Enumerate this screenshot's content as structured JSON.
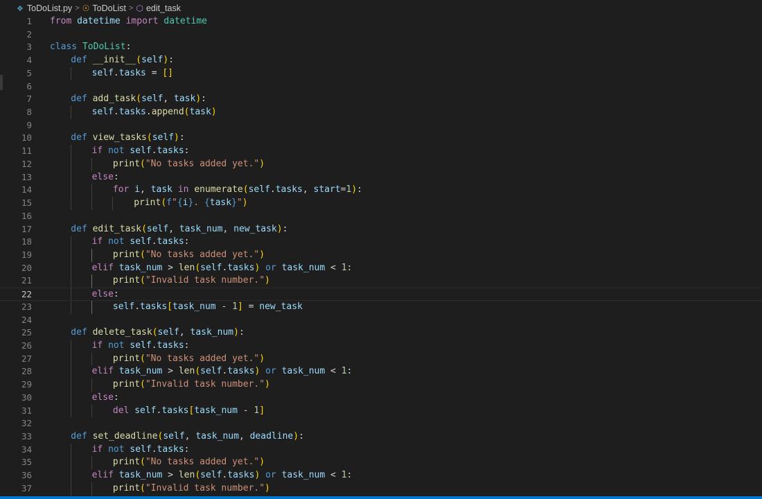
{
  "breadcrumb": {
    "file": "ToDoList.py",
    "class": "ToDoList",
    "method": "edit_task",
    "sep": ">"
  },
  "icons": {
    "python_file": "python-file-icon",
    "class": "class-symbol-icon",
    "method": "method-symbol-icon"
  },
  "editor": {
    "current_line": 22,
    "lines": [
      {
        "n": "1",
        "indent": 0,
        "tokens": [
          [
            "kw",
            "from"
          ],
          [
            "pn",
            " "
          ],
          [
            "vr",
            "datetime"
          ],
          [
            "pn",
            " "
          ],
          [
            "kw",
            "import"
          ],
          [
            "pn",
            " "
          ],
          [
            "cls",
            "datetime"
          ]
        ]
      },
      {
        "n": "2",
        "indent": 0,
        "tokens": []
      },
      {
        "n": "3",
        "indent": 0,
        "tokens": [
          [
            "dk",
            "class"
          ],
          [
            "pn",
            " "
          ],
          [
            "cls",
            "ToDoList"
          ],
          [
            "pn",
            ":"
          ]
        ]
      },
      {
        "n": "4",
        "indent": 1,
        "tokens": [
          [
            "dk",
            "def"
          ],
          [
            "pn",
            " "
          ],
          [
            "fn",
            "__init__"
          ],
          [
            "br1",
            "("
          ],
          [
            "self",
            "self"
          ],
          [
            "br1",
            ")"
          ],
          [
            "pn",
            ":"
          ]
        ]
      },
      {
        "n": "5",
        "indent": 2,
        "tokens": [
          [
            "self",
            "self"
          ],
          [
            "pn",
            "."
          ],
          [
            "vr",
            "tasks"
          ],
          [
            "pn",
            " = "
          ],
          [
            "br1",
            "[]"
          ]
        ]
      },
      {
        "n": "6",
        "indent": 1,
        "tokens": []
      },
      {
        "n": "7",
        "indent": 1,
        "tokens": [
          [
            "dk",
            "def"
          ],
          [
            "pn",
            " "
          ],
          [
            "fn",
            "add_task"
          ],
          [
            "br1",
            "("
          ],
          [
            "self",
            "self"
          ],
          [
            "pn",
            ", "
          ],
          [
            "pr",
            "task"
          ],
          [
            "br1",
            ")"
          ],
          [
            "pn",
            ":"
          ]
        ]
      },
      {
        "n": "8",
        "indent": 2,
        "tokens": [
          [
            "self",
            "self"
          ],
          [
            "pn",
            "."
          ],
          [
            "vr",
            "tasks"
          ],
          [
            "pn",
            "."
          ],
          [
            "fn",
            "append"
          ],
          [
            "br1",
            "("
          ],
          [
            "vr",
            "task"
          ],
          [
            "br1",
            ")"
          ]
        ]
      },
      {
        "n": "9",
        "indent": 1,
        "tokens": []
      },
      {
        "n": "10",
        "indent": 1,
        "tokens": [
          [
            "dk",
            "def"
          ],
          [
            "pn",
            " "
          ],
          [
            "fn",
            "view_tasks"
          ],
          [
            "br1",
            "("
          ],
          [
            "self",
            "self"
          ],
          [
            "br1",
            ")"
          ],
          [
            "pn",
            ":"
          ]
        ]
      },
      {
        "n": "11",
        "indent": 2,
        "tokens": [
          [
            "kw",
            "if"
          ],
          [
            "pn",
            " "
          ],
          [
            "dk",
            "not"
          ],
          [
            "pn",
            " "
          ],
          [
            "self",
            "self"
          ],
          [
            "pn",
            "."
          ],
          [
            "vr",
            "tasks"
          ],
          [
            "pn",
            ":"
          ]
        ]
      },
      {
        "n": "12",
        "indent": 3,
        "tokens": [
          [
            "fn",
            "print"
          ],
          [
            "br1",
            "("
          ],
          [
            "st",
            "\"No tasks added yet.\""
          ],
          [
            "br1",
            ")"
          ]
        ]
      },
      {
        "n": "13",
        "indent": 2,
        "tokens": [
          [
            "kw",
            "else"
          ],
          [
            "pn",
            ":"
          ]
        ]
      },
      {
        "n": "14",
        "indent": 3,
        "tokens": [
          [
            "kw",
            "for"
          ],
          [
            "pn",
            " "
          ],
          [
            "vr",
            "i"
          ],
          [
            "pn",
            ", "
          ],
          [
            "vr",
            "task"
          ],
          [
            "pn",
            " "
          ],
          [
            "kw",
            "in"
          ],
          [
            "pn",
            " "
          ],
          [
            "fn",
            "enumerate"
          ],
          [
            "br1",
            "("
          ],
          [
            "self",
            "self"
          ],
          [
            "pn",
            "."
          ],
          [
            "vr",
            "tasks"
          ],
          [
            "pn",
            ", "
          ],
          [
            "pr",
            "start"
          ],
          [
            "pn",
            "="
          ],
          [
            "nm",
            "1"
          ],
          [
            "br1",
            ")"
          ],
          [
            "pn",
            ":"
          ]
        ]
      },
      {
        "n": "15",
        "indent": 4,
        "tokens": [
          [
            "fn",
            "print"
          ],
          [
            "br1",
            "("
          ],
          [
            "dk",
            "f"
          ],
          [
            "st",
            "\""
          ],
          [
            "dk",
            "{"
          ],
          [
            "vr",
            "i"
          ],
          [
            "dk",
            "}"
          ],
          [
            "st",
            ". "
          ],
          [
            "dk",
            "{"
          ],
          [
            "vr",
            "task"
          ],
          [
            "dk",
            "}"
          ],
          [
            "st",
            "\""
          ],
          [
            "br1",
            ")"
          ]
        ]
      },
      {
        "n": "16",
        "indent": 1,
        "tokens": []
      },
      {
        "n": "17",
        "indent": 1,
        "tokens": [
          [
            "dk",
            "def"
          ],
          [
            "pn",
            " "
          ],
          [
            "fn",
            "edit_task"
          ],
          [
            "br1",
            "("
          ],
          [
            "self",
            "self"
          ],
          [
            "pn",
            ", "
          ],
          [
            "pr",
            "task_num"
          ],
          [
            "pn",
            ", "
          ],
          [
            "pr",
            "new_task"
          ],
          [
            "br1",
            ")"
          ],
          [
            "pn",
            ":"
          ]
        ]
      },
      {
        "n": "18",
        "indent": 2,
        "tokens": [
          [
            "kw",
            "if"
          ],
          [
            "pn",
            " "
          ],
          [
            "dk",
            "not"
          ],
          [
            "pn",
            " "
          ],
          [
            "self",
            "self"
          ],
          [
            "pn",
            "."
          ],
          [
            "vr",
            "tasks"
          ],
          [
            "pn",
            ":"
          ]
        ]
      },
      {
        "n": "19",
        "indent": 3,
        "tokens": [
          [
            "fn",
            "print"
          ],
          [
            "br1",
            "("
          ],
          [
            "st",
            "\"No tasks added yet.\""
          ],
          [
            "br1",
            ")"
          ]
        ]
      },
      {
        "n": "20",
        "indent": 2,
        "tokens": [
          [
            "kw",
            "elif"
          ],
          [
            "pn",
            " "
          ],
          [
            "vr",
            "task_num"
          ],
          [
            "pn",
            " > "
          ],
          [
            "fn",
            "len"
          ],
          [
            "br1",
            "("
          ],
          [
            "self",
            "self"
          ],
          [
            "pn",
            "."
          ],
          [
            "vr",
            "tasks"
          ],
          [
            "br1",
            ")"
          ],
          [
            "pn",
            " "
          ],
          [
            "dk",
            "or"
          ],
          [
            "pn",
            " "
          ],
          [
            "vr",
            "task_num"
          ],
          [
            "pn",
            " < "
          ],
          [
            "nm",
            "1"
          ],
          [
            "pn",
            ":"
          ]
        ]
      },
      {
        "n": "21",
        "indent": 3,
        "tokens": [
          [
            "fn",
            "print"
          ],
          [
            "br1",
            "("
          ],
          [
            "st",
            "\"Invalid task number.\""
          ],
          [
            "br1",
            ")"
          ]
        ]
      },
      {
        "n": "22",
        "indent": 2,
        "tokens": [
          [
            "kw",
            "else"
          ],
          [
            "pn",
            ":"
          ]
        ]
      },
      {
        "n": "23",
        "indent": 3,
        "tokens": [
          [
            "self",
            "self"
          ],
          [
            "pn",
            "."
          ],
          [
            "vr",
            "tasks"
          ],
          [
            "br1",
            "["
          ],
          [
            "vr",
            "task_num"
          ],
          [
            "pn",
            " - "
          ],
          [
            "nm",
            "1"
          ],
          [
            "br1",
            "]"
          ],
          [
            "pn",
            " = "
          ],
          [
            "vr",
            "new_task"
          ]
        ]
      },
      {
        "n": "24",
        "indent": 1,
        "tokens": []
      },
      {
        "n": "25",
        "indent": 1,
        "tokens": [
          [
            "dk",
            "def"
          ],
          [
            "pn",
            " "
          ],
          [
            "fn",
            "delete_task"
          ],
          [
            "br1",
            "("
          ],
          [
            "self",
            "self"
          ],
          [
            "pn",
            ", "
          ],
          [
            "pr",
            "task_num"
          ],
          [
            "br1",
            ")"
          ],
          [
            "pn",
            ":"
          ]
        ]
      },
      {
        "n": "26",
        "indent": 2,
        "tokens": [
          [
            "kw",
            "if"
          ],
          [
            "pn",
            " "
          ],
          [
            "dk",
            "not"
          ],
          [
            "pn",
            " "
          ],
          [
            "self",
            "self"
          ],
          [
            "pn",
            "."
          ],
          [
            "vr",
            "tasks"
          ],
          [
            "pn",
            ":"
          ]
        ]
      },
      {
        "n": "27",
        "indent": 3,
        "tokens": [
          [
            "fn",
            "print"
          ],
          [
            "br1",
            "("
          ],
          [
            "st",
            "\"No tasks added yet.\""
          ],
          [
            "br1",
            ")"
          ]
        ]
      },
      {
        "n": "28",
        "indent": 2,
        "tokens": [
          [
            "kw",
            "elif"
          ],
          [
            "pn",
            " "
          ],
          [
            "vr",
            "task_num"
          ],
          [
            "pn",
            " > "
          ],
          [
            "fn",
            "len"
          ],
          [
            "br1",
            "("
          ],
          [
            "self",
            "self"
          ],
          [
            "pn",
            "."
          ],
          [
            "vr",
            "tasks"
          ],
          [
            "br1",
            ")"
          ],
          [
            "pn",
            " "
          ],
          [
            "dk",
            "or"
          ],
          [
            "pn",
            " "
          ],
          [
            "vr",
            "task_num"
          ],
          [
            "pn",
            " < "
          ],
          [
            "nm",
            "1"
          ],
          [
            "pn",
            ":"
          ]
        ]
      },
      {
        "n": "29",
        "indent": 3,
        "tokens": [
          [
            "fn",
            "print"
          ],
          [
            "br1",
            "("
          ],
          [
            "st",
            "\"Invalid task number.\""
          ],
          [
            "br1",
            ")"
          ]
        ]
      },
      {
        "n": "30",
        "indent": 2,
        "tokens": [
          [
            "kw",
            "else"
          ],
          [
            "pn",
            ":"
          ]
        ]
      },
      {
        "n": "31",
        "indent": 3,
        "tokens": [
          [
            "kw",
            "del"
          ],
          [
            "pn",
            " "
          ],
          [
            "self",
            "self"
          ],
          [
            "pn",
            "."
          ],
          [
            "vr",
            "tasks"
          ],
          [
            "br1",
            "["
          ],
          [
            "vr",
            "task_num"
          ],
          [
            "pn",
            " - "
          ],
          [
            "nm",
            "1"
          ],
          [
            "br1",
            "]"
          ]
        ]
      },
      {
        "n": "32",
        "indent": 1,
        "tokens": []
      },
      {
        "n": "33",
        "indent": 1,
        "tokens": [
          [
            "dk",
            "def"
          ],
          [
            "pn",
            " "
          ],
          [
            "fn",
            "set_deadline"
          ],
          [
            "br1",
            "("
          ],
          [
            "self",
            "self"
          ],
          [
            "pn",
            ", "
          ],
          [
            "pr",
            "task_num"
          ],
          [
            "pn",
            ", "
          ],
          [
            "pr",
            "deadline"
          ],
          [
            "br1",
            ")"
          ],
          [
            "pn",
            ":"
          ]
        ]
      },
      {
        "n": "34",
        "indent": 2,
        "tokens": [
          [
            "kw",
            "if"
          ],
          [
            "pn",
            " "
          ],
          [
            "dk",
            "not"
          ],
          [
            "pn",
            " "
          ],
          [
            "self",
            "self"
          ],
          [
            "pn",
            "."
          ],
          [
            "vr",
            "tasks"
          ],
          [
            "pn",
            ":"
          ]
        ]
      },
      {
        "n": "35",
        "indent": 3,
        "tokens": [
          [
            "fn",
            "print"
          ],
          [
            "br1",
            "("
          ],
          [
            "st",
            "\"No tasks added yet.\""
          ],
          [
            "br1",
            ")"
          ]
        ]
      },
      {
        "n": "36",
        "indent": 2,
        "tokens": [
          [
            "kw",
            "elif"
          ],
          [
            "pn",
            " "
          ],
          [
            "vr",
            "task_num"
          ],
          [
            "pn",
            " > "
          ],
          [
            "fn",
            "len"
          ],
          [
            "br1",
            "("
          ],
          [
            "self",
            "self"
          ],
          [
            "pn",
            "."
          ],
          [
            "vr",
            "tasks"
          ],
          [
            "br1",
            ")"
          ],
          [
            "pn",
            " "
          ],
          [
            "dk",
            "or"
          ],
          [
            "pn",
            " "
          ],
          [
            "vr",
            "task_num"
          ],
          [
            "pn",
            " < "
          ],
          [
            "nm",
            "1"
          ],
          [
            "pn",
            ":"
          ]
        ]
      },
      {
        "n": "37",
        "indent": 3,
        "tokens": [
          [
            "fn",
            "print"
          ],
          [
            "br1",
            "("
          ],
          [
            "st",
            "\"Invalid task number.\""
          ],
          [
            "br1",
            ")"
          ]
        ]
      }
    ]
  },
  "colors": {
    "background": "#1e1e1e",
    "accent": "#007acc",
    "keyword": "#c586c0",
    "storage": "#569cd6",
    "function": "#dcdcaa",
    "class": "#4ec9b0",
    "string": "#ce9178",
    "number": "#b5cea8",
    "variable": "#9cdcfe"
  }
}
